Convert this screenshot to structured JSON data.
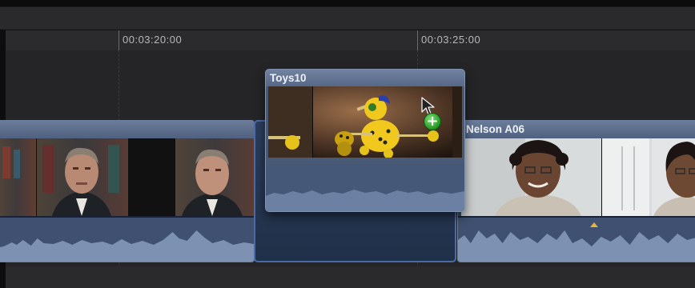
{
  "ruler": {
    "timecodes": [
      "00:03:20:00",
      "00:03:25:00"
    ]
  },
  "clips": {
    "left": {
      "title": ""
    },
    "dragged": {
      "title": "Toys10"
    },
    "right": {
      "title": "Nelson A06"
    }
  },
  "badges": {
    "add_symbol": "+"
  },
  "colors": {
    "clip_blue": "#4f6180",
    "gap_outline": "#4b6aa8",
    "add_green": "#22961f",
    "marker_yellow": "#e3b53f"
  },
  "icons": [
    "pointer-cursor-icon",
    "add-plus-icon",
    "marker-icon"
  ]
}
